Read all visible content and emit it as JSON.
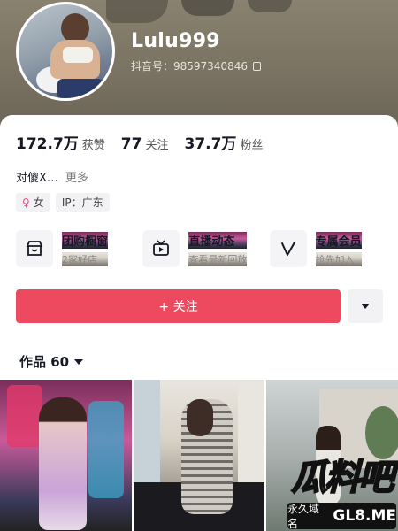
{
  "profile": {
    "name": "Lulu999",
    "douyin_id": "抖音号：98597340846"
  },
  "stats": [
    {
      "num": "172.7万",
      "label": "获赞"
    },
    {
      "num": "77",
      "label": "关注"
    },
    {
      "num": "37.7万",
      "label": "粉丝"
    }
  ],
  "bio": {
    "text": "对傻X…",
    "more": "更多"
  },
  "tags": {
    "gender": "女",
    "ip": "IP：广东"
  },
  "features": [
    {
      "title": "团购橱窗",
      "sub": "2家好店",
      "icon": "store-icon"
    },
    {
      "title": "直播动态",
      "sub": "查看最新回放",
      "icon": "live-tv-icon"
    },
    {
      "title": "专属会员",
      "sub": "抢先加入",
      "icon": "vip-v-icon"
    }
  ],
  "actions": {
    "follow": "+ 关注"
  },
  "works": {
    "label": "作品 60"
  },
  "watermark": {
    "title": "瓜料吧",
    "cn": "永久域名",
    "en": "GL8.ME"
  },
  "colors": {
    "accent": "#ee4a5f",
    "female": "#f0408a"
  }
}
